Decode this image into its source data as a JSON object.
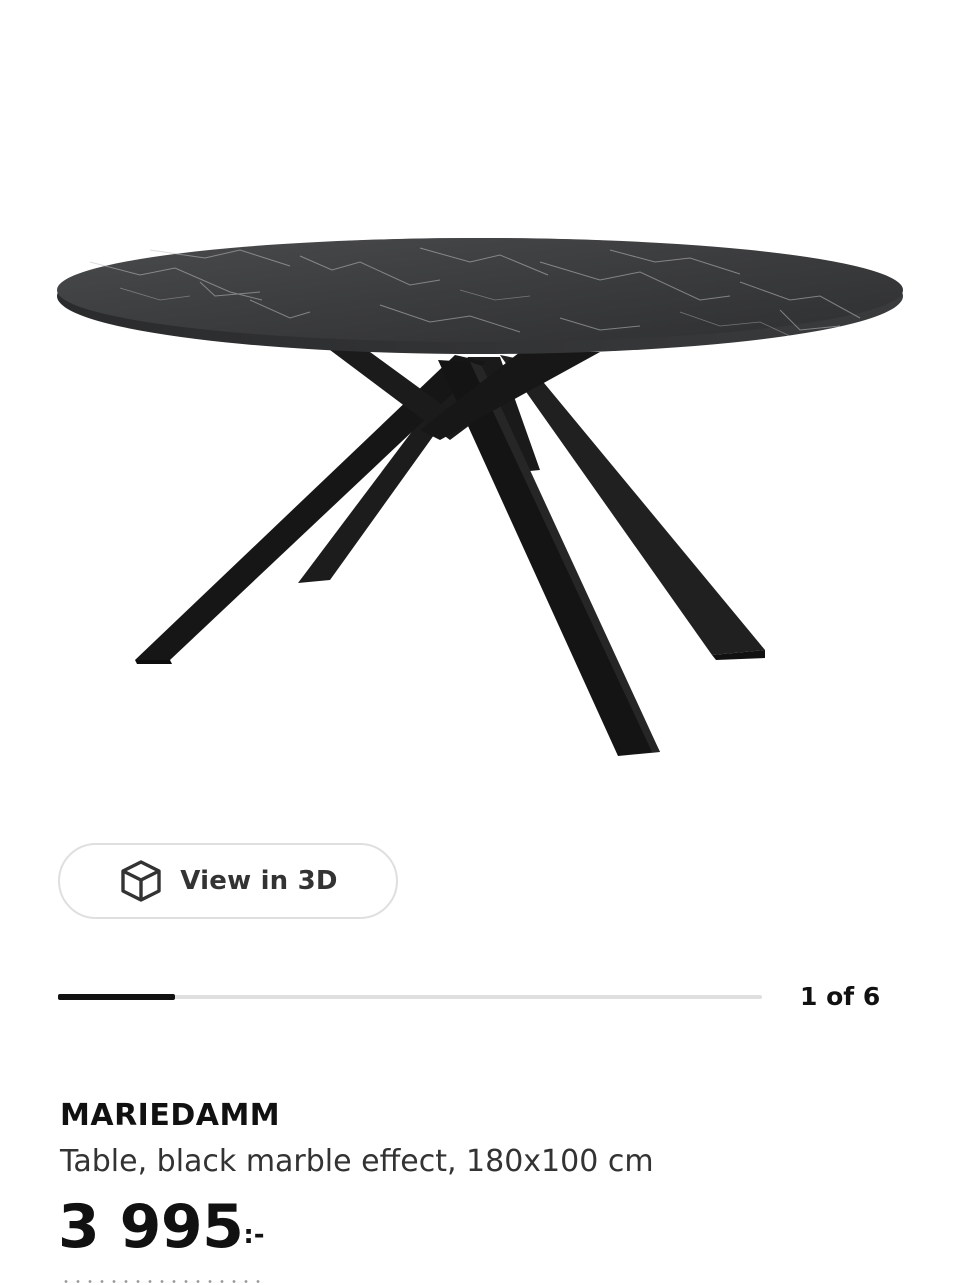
{
  "product_image": {
    "alt": "Oval table with black marble effect top and crossed black legs"
  },
  "view3d": {
    "icon": "cube-icon",
    "label": "View in 3D"
  },
  "gallery": {
    "pager_text": "1 of 6",
    "current": 1,
    "total": 6,
    "progress_fraction": 0.1667
  },
  "product": {
    "name": "MARIEDAMM",
    "description": "Table, black marble effect, 180x100 cm",
    "price_main": "3 995",
    "price_suffix": ":-"
  },
  "colors": {
    "accent": "#111111",
    "track": "#dfdfdf",
    "button_border": "#dfdfdf"
  }
}
